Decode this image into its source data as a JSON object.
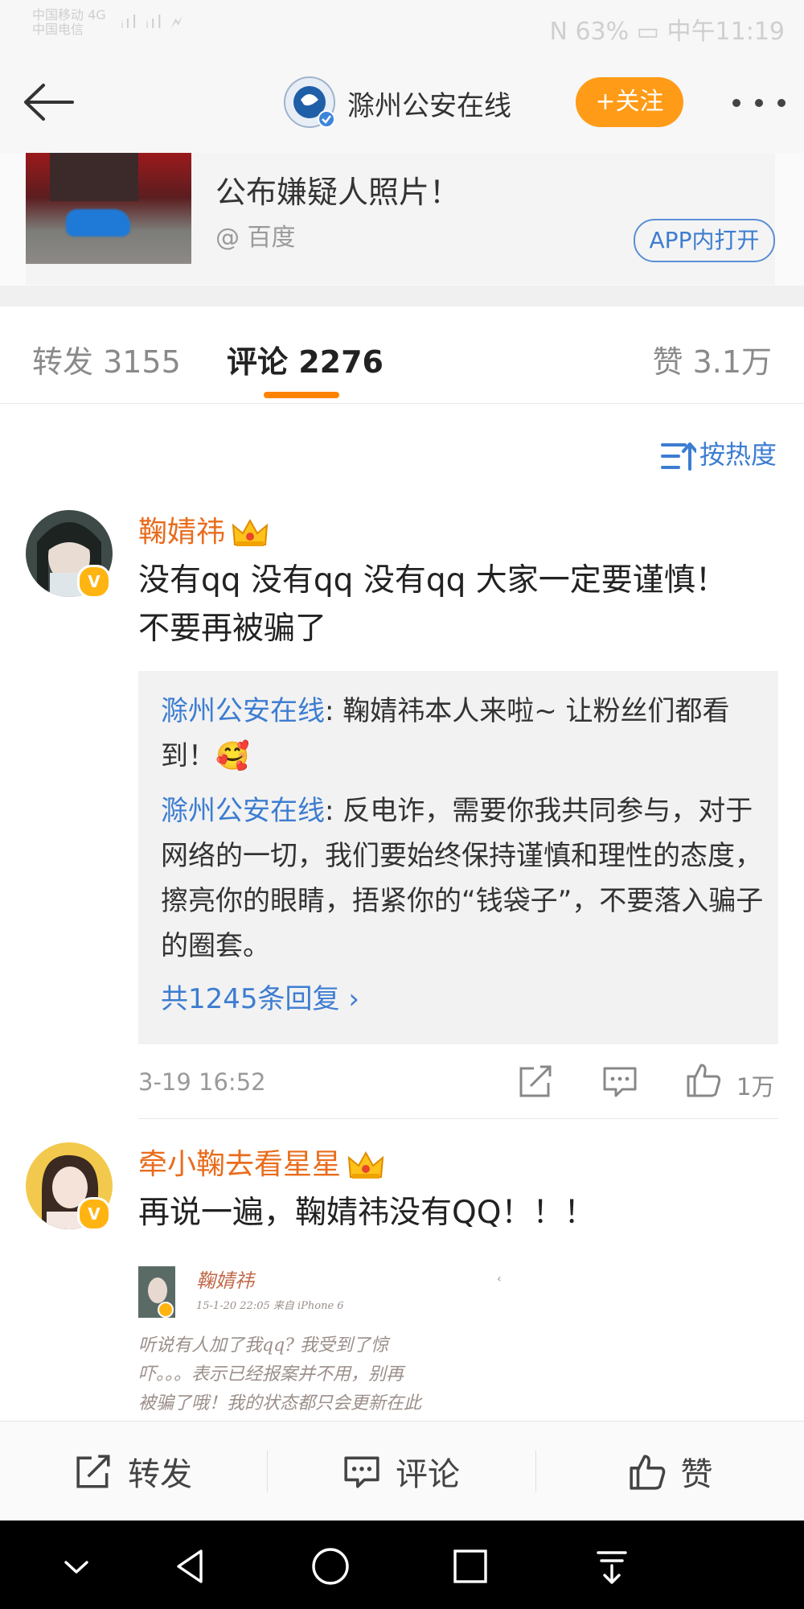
{
  "status_bar": {
    "carrier_line1": "中国移动 4G",
    "carrier_line2": "中国电信",
    "signal": "ᵢıl ᵢıl 🗲",
    "right": "N 63% ▭ 中午11:19"
  },
  "header": {
    "title": "滁州公安在线",
    "follow_label": "+关注"
  },
  "card": {
    "title": "公布嫌疑人照片！",
    "source": "@ 百度",
    "app_open_label": "APP内打开"
  },
  "tabs": {
    "repost": "转发 3155",
    "comment": "评论 2276",
    "like": "赞 3.1万"
  },
  "sort": {
    "label": "按热度"
  },
  "comments": [
    {
      "username": "鞠婧祎",
      "text": "没有qq 没有qq 没有qq 大家一定要谨慎！不要再被骗了",
      "replies": [
        {
          "author": "滁州公安在线",
          "text": ": 鞠婧祎本人来啦~ 让粉丝们都看到！🥰"
        },
        {
          "author": "滁州公安在线",
          "text": ": 反电诈，需要你我共同参与，对于网络的一切，我们要始终保持谨慎和理性的态度，擦亮你的眼睛，捂紧你的“钱袋子”，不要落入骗子的圈套。"
        }
      ],
      "more_replies": "共1245条回复 ›",
      "time": "3-19 16:52",
      "likes": "1万"
    },
    {
      "username": "牵小鞠去看星星",
      "text": "再说一遍，鞠婧祎没有QQ！！！",
      "embed": {
        "name": "鞠婧祎",
        "meta": "15-1-20  22:05  来自  iPhone 6",
        "lines": [
          "听说有人加了我qq?    我受到了惊",
          "吓。。。表示已经报案并不用，别再",
          "被骗了哦！我的状态都只会更新在此",
          "……"
        ]
      }
    }
  ],
  "bottom_bar": {
    "repost": "转发",
    "comment": "评论",
    "like": "赞"
  },
  "colors": {
    "accent_orange": "#ff8200",
    "follow_button": "#ff9b16",
    "link_blue": "#3d7dd1",
    "username_orange": "#e96c1c",
    "vip_badge": "#ffb411"
  }
}
